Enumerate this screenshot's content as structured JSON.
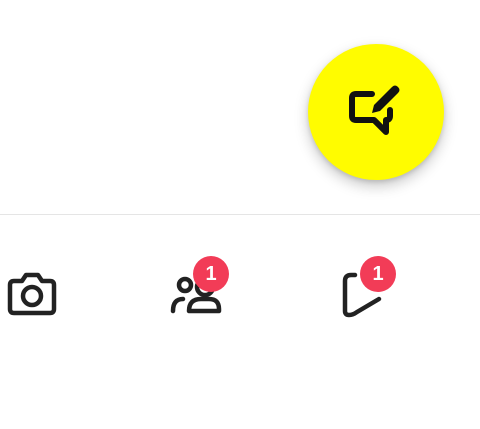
{
  "fab": {
    "icon": "new-chat-icon",
    "color": "#FFFC00",
    "icon_color": "#111111"
  },
  "divider_color": "#E5E5E5",
  "nav": {
    "icon_color": "#222222",
    "badge_color": "#F23C57",
    "items": [
      {
        "icon": "camera-icon"
      },
      {
        "icon": "friends-icon",
        "badge": "1"
      },
      {
        "icon": "stories-icon",
        "badge": "1"
      }
    ]
  }
}
